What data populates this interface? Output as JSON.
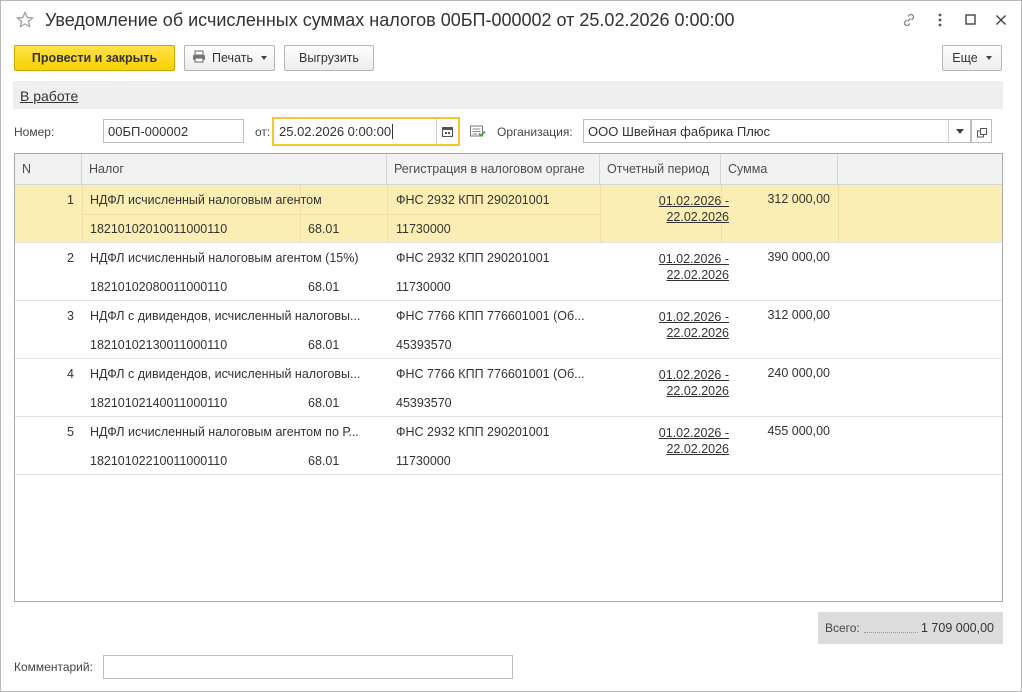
{
  "window": {
    "title": "Уведомление об исчисленных суммах налогов 00БП-000002 от 25.02.2026 0:00:00"
  },
  "toolbar": {
    "post_close_label": "Провести и закрыть",
    "print_label": "Печать",
    "export_label": "Выгрузить",
    "more_label": "Еще"
  },
  "status": {
    "link_label": "В работе"
  },
  "header": {
    "number_label": "Номер:",
    "number_value": "00БП-000002",
    "date_label": "от:",
    "date_value": "25.02.2026  0:00:00",
    "org_label": "Организация:",
    "org_value": "ООО Швейная фабрика Плюс"
  },
  "table": {
    "columns": [
      "N",
      "Налог",
      "Регистрация в налоговом органе",
      "Отчетный период",
      "Сумма"
    ],
    "rows": [
      {
        "n": "1",
        "tax": "НДФЛ исчисленный налоговым агентом",
        "kbk": "18210102010011000110",
        "account": "68.01",
        "registration": "ФНС 2932 КПП 290201001",
        "oktmo": "11730000",
        "period_from": "01.02.2026 -",
        "period_to": "22.02.2026",
        "amount": "312 000,00"
      },
      {
        "n": "2",
        "tax": "НДФЛ исчисленный налоговым агентом (15%)",
        "kbk": "18210102080011000110",
        "account": "68.01",
        "registration": "ФНС 2932 КПП 290201001",
        "oktmo": "11730000",
        "period_from": "01.02.2026 -",
        "period_to": "22.02.2026",
        "amount": "390 000,00"
      },
      {
        "n": "3",
        "tax": "НДФЛ с дивидендов, исчисленный налоговы...",
        "kbk": "18210102130011000110",
        "account": "68.01",
        "registration": "ФНС 7766 КПП 776601001 (Об...",
        "oktmo": "45393570",
        "period_from": "01.02.2026 -",
        "period_to": "22.02.2026",
        "amount": "312 000,00"
      },
      {
        "n": "4",
        "tax": "НДФЛ с дивидендов, исчисленный налоговы...",
        "kbk": "18210102140011000110",
        "account": "68.01",
        "registration": "ФНС 7766 КПП 776601001 (Об...",
        "oktmo": "45393570",
        "period_from": "01.02.2026 -",
        "period_to": "22.02.2026",
        "amount": "240 000,00"
      },
      {
        "n": "5",
        "tax": "НДФЛ исчисленный налоговым агентом по Р...",
        "kbk": "18210102210011000110",
        "account": "68.01",
        "registration": "ФНС 2932 КПП 290201001",
        "oktmo": "11730000",
        "period_from": "01.02.2026 -",
        "period_to": "22.02.2026",
        "amount": "455 000,00"
      }
    ]
  },
  "totals": {
    "label": "Всего:",
    "value": "1 709 000,00"
  },
  "comment": {
    "label": "Комментарий:",
    "value": ""
  },
  "icons": {
    "favorite": "star-icon",
    "link": "link-icon",
    "menu": "more-vertical-icon",
    "maximize": "maximize-icon",
    "close": "close-icon",
    "print": "printer-icon",
    "calendar": "calendar-icon",
    "history": "history-icon"
  },
  "colors": {
    "primary_button": "#f7d100",
    "selected_row": "#fbeeb4",
    "focus_border": "#f3c72d"
  }
}
